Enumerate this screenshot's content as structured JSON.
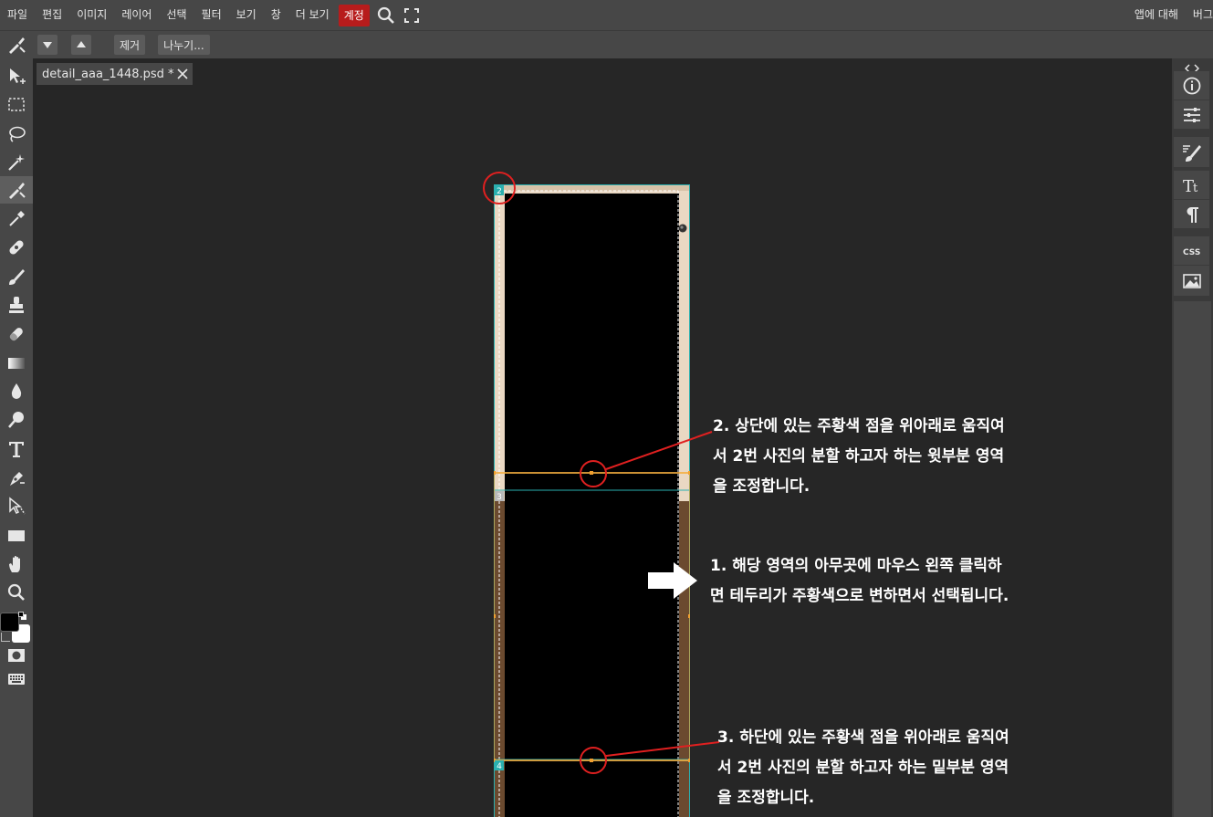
{
  "menu": {
    "items": [
      "파일",
      "편집",
      "이미지",
      "레이어",
      "선택",
      "필터",
      "보기",
      "창",
      "더 보기"
    ],
    "account": "계정",
    "right_items": [
      "앱에 대해",
      "버그"
    ]
  },
  "options": {
    "remove_label": "제거",
    "split_label": "나누기..."
  },
  "document": {
    "tab_title": "detail_aaa_1448.psd *",
    "slice_numbers": [
      "2",
      "3",
      "4"
    ]
  },
  "annotations": {
    "step2": [
      "2. 상단에 있는 주황색 점을 위아래로 움직여",
      "서 2번 사진의 분할 하고자 하는 윗부분 영역",
      "을 조정합니다."
    ],
    "step1": [
      "1. 해당 영역의 아무곳에 마우스 왼쪽 클릭하",
      "면 테두리가 주황색으로 변하면서 선택됩니다."
    ],
    "step3": [
      "3. 하단에 있는 주황색 점을 위아래로 움직여",
      "서 2번 사진의 분할 하고자 하는 밑부분 영역",
      "을 조정합니다."
    ]
  },
  "colors": {
    "accent_account": "#b71c1c",
    "selection_orange": "#f0a030",
    "slice_teal": "#2ab0b0",
    "annotation_red": "#e02020"
  },
  "icons": {
    "toolbar": [
      "move-icon",
      "marquee-icon",
      "lasso-icon",
      "magic-wand-icon",
      "slice-icon",
      "eyedropper-icon",
      "healing-icon",
      "brush-icon",
      "stamp-icon",
      "eraser-icon",
      "gradient-icon",
      "blur-icon",
      "dodge-icon",
      "type-icon",
      "pen-icon",
      "path-select-icon",
      "shape-icon",
      "hand-icon",
      "zoom-icon"
    ],
    "right_panel": [
      "info-icon",
      "adjustments-icon",
      "brush-settings-icon",
      "character-icon",
      "paragraph-icon",
      "css-icon",
      "image-icon"
    ]
  }
}
